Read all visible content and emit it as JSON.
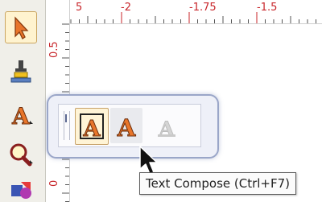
{
  "ruler": {
    "top_labels": [
      "-2",
      "-1.75",
      "-1.5"
    ],
    "left_labels": [
      "0.5",
      "0"
    ],
    "accent_color": "#c8252a"
  },
  "toolbar": {
    "tools": [
      {
        "name": "select",
        "icon": "arrow-select-icon"
      },
      {
        "name": "stamp",
        "icon": "stamp-icon"
      },
      {
        "name": "text",
        "icon": "text-tool-icon"
      },
      {
        "name": "zoom",
        "icon": "zoom-icon"
      },
      {
        "name": "shapes",
        "icon": "shapes-icon"
      }
    ]
  },
  "flyout": {
    "items": [
      {
        "name": "text-frame",
        "icon": "text-frame-icon",
        "state": "selected"
      },
      {
        "name": "text-compose",
        "icon": "text-compose-icon",
        "state": "hover"
      },
      {
        "name": "text-disabled",
        "icon": "text-disabled-icon",
        "state": "disabled"
      }
    ]
  },
  "tooltip": {
    "text": "Text Compose (Ctrl+F7)"
  }
}
